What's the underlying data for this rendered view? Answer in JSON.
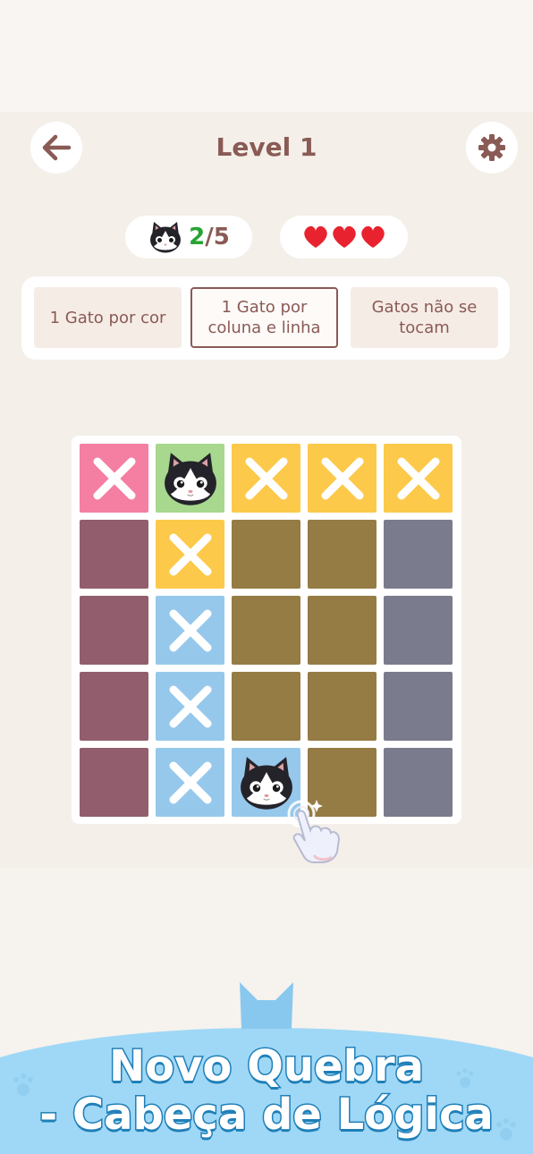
{
  "header": {
    "title": "Level 1",
    "back_icon": "back-arrow-icon",
    "settings_icon": "gear-icon"
  },
  "status": {
    "found": "2",
    "separator_total": "/5",
    "lives": 3,
    "life_icon": "heart-icon",
    "progress_icon": "cat-face-icon"
  },
  "rules": [
    {
      "label": "1 Gato por cor",
      "active": false
    },
    {
      "label": "1 Gato por coluna e linha",
      "active": true
    },
    {
      "label": "Gatos não se tocam",
      "active": false
    }
  ],
  "board": {
    "rows": [
      [
        {
          "color": "pink",
          "mark": "x"
        },
        {
          "color": "green",
          "mark": "cat"
        },
        {
          "color": "yellow",
          "mark": "x"
        },
        {
          "color": "yellow",
          "mark": "x"
        },
        {
          "color": "yellow",
          "mark": "x"
        }
      ],
      [
        {
          "color": "plum",
          "mark": ""
        },
        {
          "color": "yellow",
          "mark": "x"
        },
        {
          "color": "olive",
          "mark": ""
        },
        {
          "color": "olive",
          "mark": ""
        },
        {
          "color": "slate",
          "mark": ""
        }
      ],
      [
        {
          "color": "plum",
          "mark": ""
        },
        {
          "color": "blue",
          "mark": "x"
        },
        {
          "color": "olive",
          "mark": ""
        },
        {
          "color": "olive",
          "mark": ""
        },
        {
          "color": "slate",
          "mark": ""
        }
      ],
      [
        {
          "color": "plum",
          "mark": ""
        },
        {
          "color": "blue",
          "mark": "x"
        },
        {
          "color": "olive",
          "mark": ""
        },
        {
          "color": "olive",
          "mark": ""
        },
        {
          "color": "slate",
          "mark": ""
        }
      ],
      [
        {
          "color": "plum",
          "mark": ""
        },
        {
          "color": "blue",
          "mark": "x"
        },
        {
          "color": "blue",
          "mark": "cat"
        },
        {
          "color": "olive",
          "mark": ""
        },
        {
          "color": "slate",
          "mark": ""
        }
      ]
    ],
    "palette": {
      "pink": "#f47fa2",
      "green": "#a7d88d",
      "yellow": "#fcc94a",
      "plum": "#925e6d",
      "olive": "#957c44",
      "slate": "#7a7c8d",
      "blue": "#96c8ec"
    }
  },
  "banner": {
    "line1": "Novo Quebra",
    "line2": "- Cabeça de Lógica"
  },
  "colors": {
    "accent": "#8a5a55",
    "progress_green": "#27a334",
    "heart": "#e8232f",
    "banner_blue": "#9fd8f6"
  }
}
